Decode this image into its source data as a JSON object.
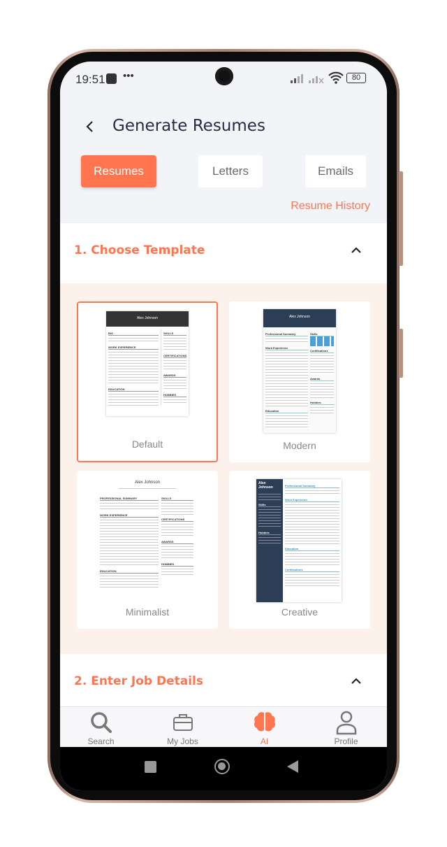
{
  "status_bar": {
    "time": "19:51",
    "battery": "80",
    "icons": [
      "stop-icon",
      "more-icon",
      "signal-icon",
      "no-signal-icon",
      "wifi-icon",
      "battery-icon"
    ]
  },
  "header": {
    "title": "Generate Resumes",
    "back_icon": "chevron-left-icon"
  },
  "tabs": [
    {
      "label": "Resumes",
      "active": true
    },
    {
      "label": "Letters",
      "active": false
    },
    {
      "label": "Emails",
      "active": false
    }
  ],
  "resume_history": "Resume History",
  "section1": {
    "title": "1. Choose Template",
    "icon": "chevron-up-icon"
  },
  "templates": [
    {
      "label": "Default",
      "selected": true,
      "name": "Alex Johnson",
      "headings": [
        "BIO",
        "WORK EXPERIENCE",
        "EDUCATION",
        "SKILLS",
        "CERTIFICATIONS",
        "AWARDS",
        "HOBBIES"
      ]
    },
    {
      "label": "Modern",
      "selected": false,
      "name": "Alex Johnson",
      "headings": [
        "Professional Summary",
        "Work Experience",
        "Education",
        "Skills",
        "Certifications",
        "Awards",
        "Hobbies"
      ]
    },
    {
      "label": "Minimalist",
      "selected": false,
      "name": "Alex Johnson",
      "headings": [
        "PROFESSIONAL SUMMARY",
        "WORK EXPERIENCE",
        "EDUCATION",
        "SKILLS",
        "CERTIFICATIONS",
        "AWARDS",
        "HOBBIES"
      ]
    },
    {
      "label": "Creative",
      "selected": false,
      "name": "Alex Johnson",
      "headings": [
        "Professional Summary",
        "Work Experience",
        "Education",
        "Certifications",
        "Skills",
        "Hobbies"
      ]
    }
  ],
  "section2": {
    "title": "2. Enter Job Details",
    "icon": "chevron-up-icon"
  },
  "bottom_nav": [
    {
      "label": "Search",
      "icon": "search-icon"
    },
    {
      "label": "My Jobs",
      "icon": "briefcase-icon"
    },
    {
      "label": "AI",
      "icon": "brain-icon",
      "active": true
    },
    {
      "label": "Profile",
      "icon": "user-icon"
    }
  ],
  "colors": {
    "accent": "#ff7550",
    "peach_bg": "#fdf1ec",
    "title": "#2a2a45",
    "modern_header": "#2c3e55"
  }
}
